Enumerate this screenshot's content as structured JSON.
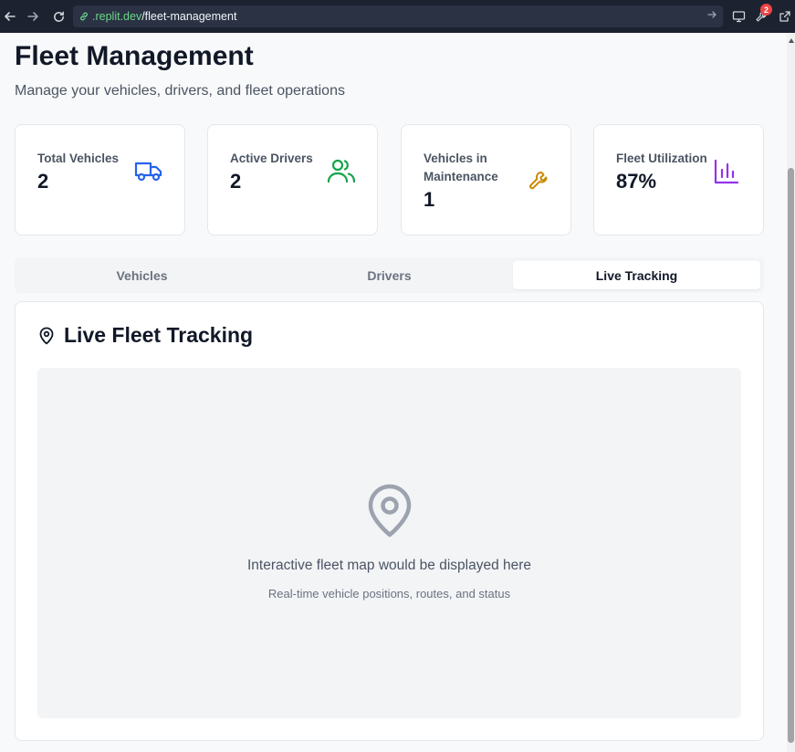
{
  "browser": {
    "url_domain": ".replit.dev",
    "url_path": "/fleet-management",
    "badge_count": "2"
  },
  "header": {
    "title": "Fleet Management",
    "subtitle": "Manage your vehicles, drivers, and fleet operations"
  },
  "stats": [
    {
      "label": "Total Vehicles",
      "value": "2",
      "icon": "truck-icon",
      "color": "#2563eb"
    },
    {
      "label": "Active Drivers",
      "value": "2",
      "icon": "users-icon",
      "color": "#16a34a"
    },
    {
      "label": "Vehicles in Maintenance",
      "value": "1",
      "icon": "wrench-icon",
      "color": "#ca8a04"
    },
    {
      "label": "Fleet Utilization",
      "value": "87%",
      "icon": "bar-chart-icon",
      "color": "#9333ea"
    }
  ],
  "tabs": [
    {
      "label": "Vehicles",
      "active": false
    },
    {
      "label": "Drivers",
      "active": false
    },
    {
      "label": "Live Tracking",
      "active": true
    }
  ],
  "panel": {
    "title": "Live Fleet Tracking",
    "icon": "map-pin-icon",
    "map_message": "Interactive fleet map would be displayed here",
    "map_submessage": "Real-time vehicle positions, routes, and status"
  }
}
